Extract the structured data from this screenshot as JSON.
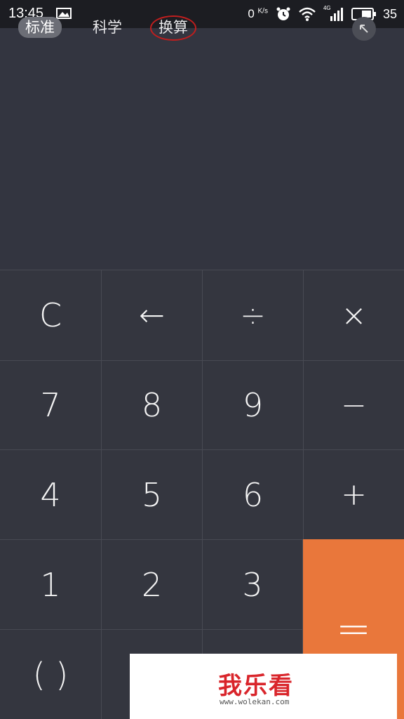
{
  "status_bar": {
    "time": "13:45",
    "net_speed_value": "0",
    "net_speed_unit": "K/s",
    "network": "4G",
    "battery": "35",
    "icons": [
      "image-icon",
      "alarm-icon",
      "wifi-icon",
      "signal-icon",
      "battery-icon"
    ]
  },
  "mode_tabs": [
    {
      "label": "标准",
      "selected": true
    },
    {
      "label": "科学",
      "selected": false
    },
    {
      "label": "换算",
      "selected": false
    }
  ],
  "keypad": {
    "rows": [
      [
        "C",
        "←",
        "÷",
        "×"
      ],
      [
        "7",
        "8",
        "9",
        "−"
      ],
      [
        "4",
        "5",
        "6",
        "+"
      ],
      [
        "1",
        "2",
        "3"
      ],
      [
        "( )"
      ]
    ],
    "equals": "="
  },
  "watermark": {
    "logo_text": "我乐看",
    "url": "www.wolekan.com"
  },
  "colors": {
    "background": "#2f3139",
    "status_bar": "#1c1d22",
    "equals_key": "#e9773b",
    "annotation_ring": "#c01e1e"
  }
}
